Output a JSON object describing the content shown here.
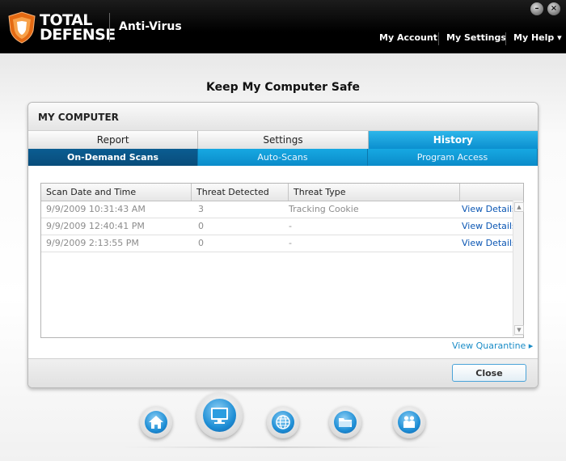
{
  "header": {
    "brand_line1": "TOTAL",
    "brand_line2": "DEFENSE",
    "product": "Anti-Virus",
    "nav": {
      "my_account": "My Account",
      "my_settings": "My Settings",
      "my_help": "My Help ▾"
    },
    "window_controls": {
      "minimize": "–",
      "close": "×"
    }
  },
  "page": {
    "title": "Keep My Computer Safe"
  },
  "panel": {
    "title": "MY COMPUTER",
    "tabs": [
      "Report",
      "Settings",
      "History"
    ],
    "active_tab": "History",
    "subtabs": [
      "On-Demand Scans",
      "Auto-Scans",
      "Program Access"
    ],
    "active_subtab": "On-Demand Scans",
    "table": {
      "columns": [
        "Scan Date and Time",
        "Threat Detected",
        "Threat Type",
        ""
      ],
      "rows": [
        {
          "date": "9/9/2009 10:31:43 AM",
          "threats": "3",
          "type": "Tracking Cookie",
          "action": "View Details"
        },
        {
          "date": "9/9/2009 12:40:41 PM",
          "threats": "0",
          "type": "-",
          "action": "View Details"
        },
        {
          "date": "9/9/2009 2:13:55 PM",
          "threats": "0",
          "type": "-",
          "action": "View Details"
        }
      ]
    },
    "view_quarantine": "View Quarantine ▸",
    "close_button": "Close"
  },
  "dock": [
    "home-icon",
    "computer-icon",
    "globe-icon",
    "folder-icon",
    "family-icon"
  ],
  "colors": {
    "accent_blue": "#0b8fcf",
    "dark_blue": "#084c7a",
    "link_blue": "#0b56b3"
  }
}
